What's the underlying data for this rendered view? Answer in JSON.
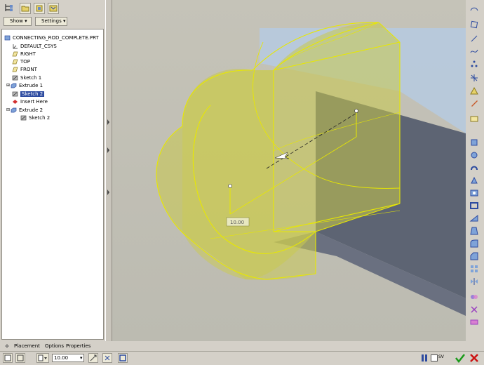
{
  "toolbar": {
    "show_label": "Show",
    "settings_label": "Settings"
  },
  "model_tree": {
    "items": [
      {
        "label": "CONNECTING_ROD_COMPLETE.PRT",
        "icon": "part-icon"
      },
      {
        "label": "DEFAULT_CSYS",
        "icon": "csys-icon"
      },
      {
        "label": "RIGHT",
        "icon": "datum-plane-icon"
      },
      {
        "label": "TOP",
        "icon": "datum-plane-icon"
      },
      {
        "label": "FRONT",
        "icon": "datum-plane-icon"
      },
      {
        "label": "Sketch 1",
        "icon": "sketch-icon"
      },
      {
        "label": "Extrude 1",
        "icon": "extrude-icon"
      },
      {
        "label": "Sketch 2",
        "icon": "sketch-icon",
        "selected": true
      },
      {
        "label": "Insert Here",
        "icon": "insert-here-icon"
      },
      {
        "label": "Extrude 2",
        "icon": "extrude-icon"
      },
      {
        "label": "Sketch 2",
        "icon": "sketch-icon"
      }
    ]
  },
  "viewport": {
    "dimension_label": "10.00"
  },
  "dashboard": {
    "tabs": [
      "Placement",
      "Options",
      "Properties"
    ]
  },
  "status_bar": {
    "depth_value": "10.00",
    "preview_label": "SV"
  },
  "colors": {
    "feature_yellow": "#c9c84a",
    "edge_yellow": "#e8e800",
    "preview_blue": "#b7c9dc",
    "preview_dark": "#5d6473",
    "selection": "#2d4ba0",
    "accept_green": "#1a9a1a",
    "cancel_red": "#cc1111"
  }
}
